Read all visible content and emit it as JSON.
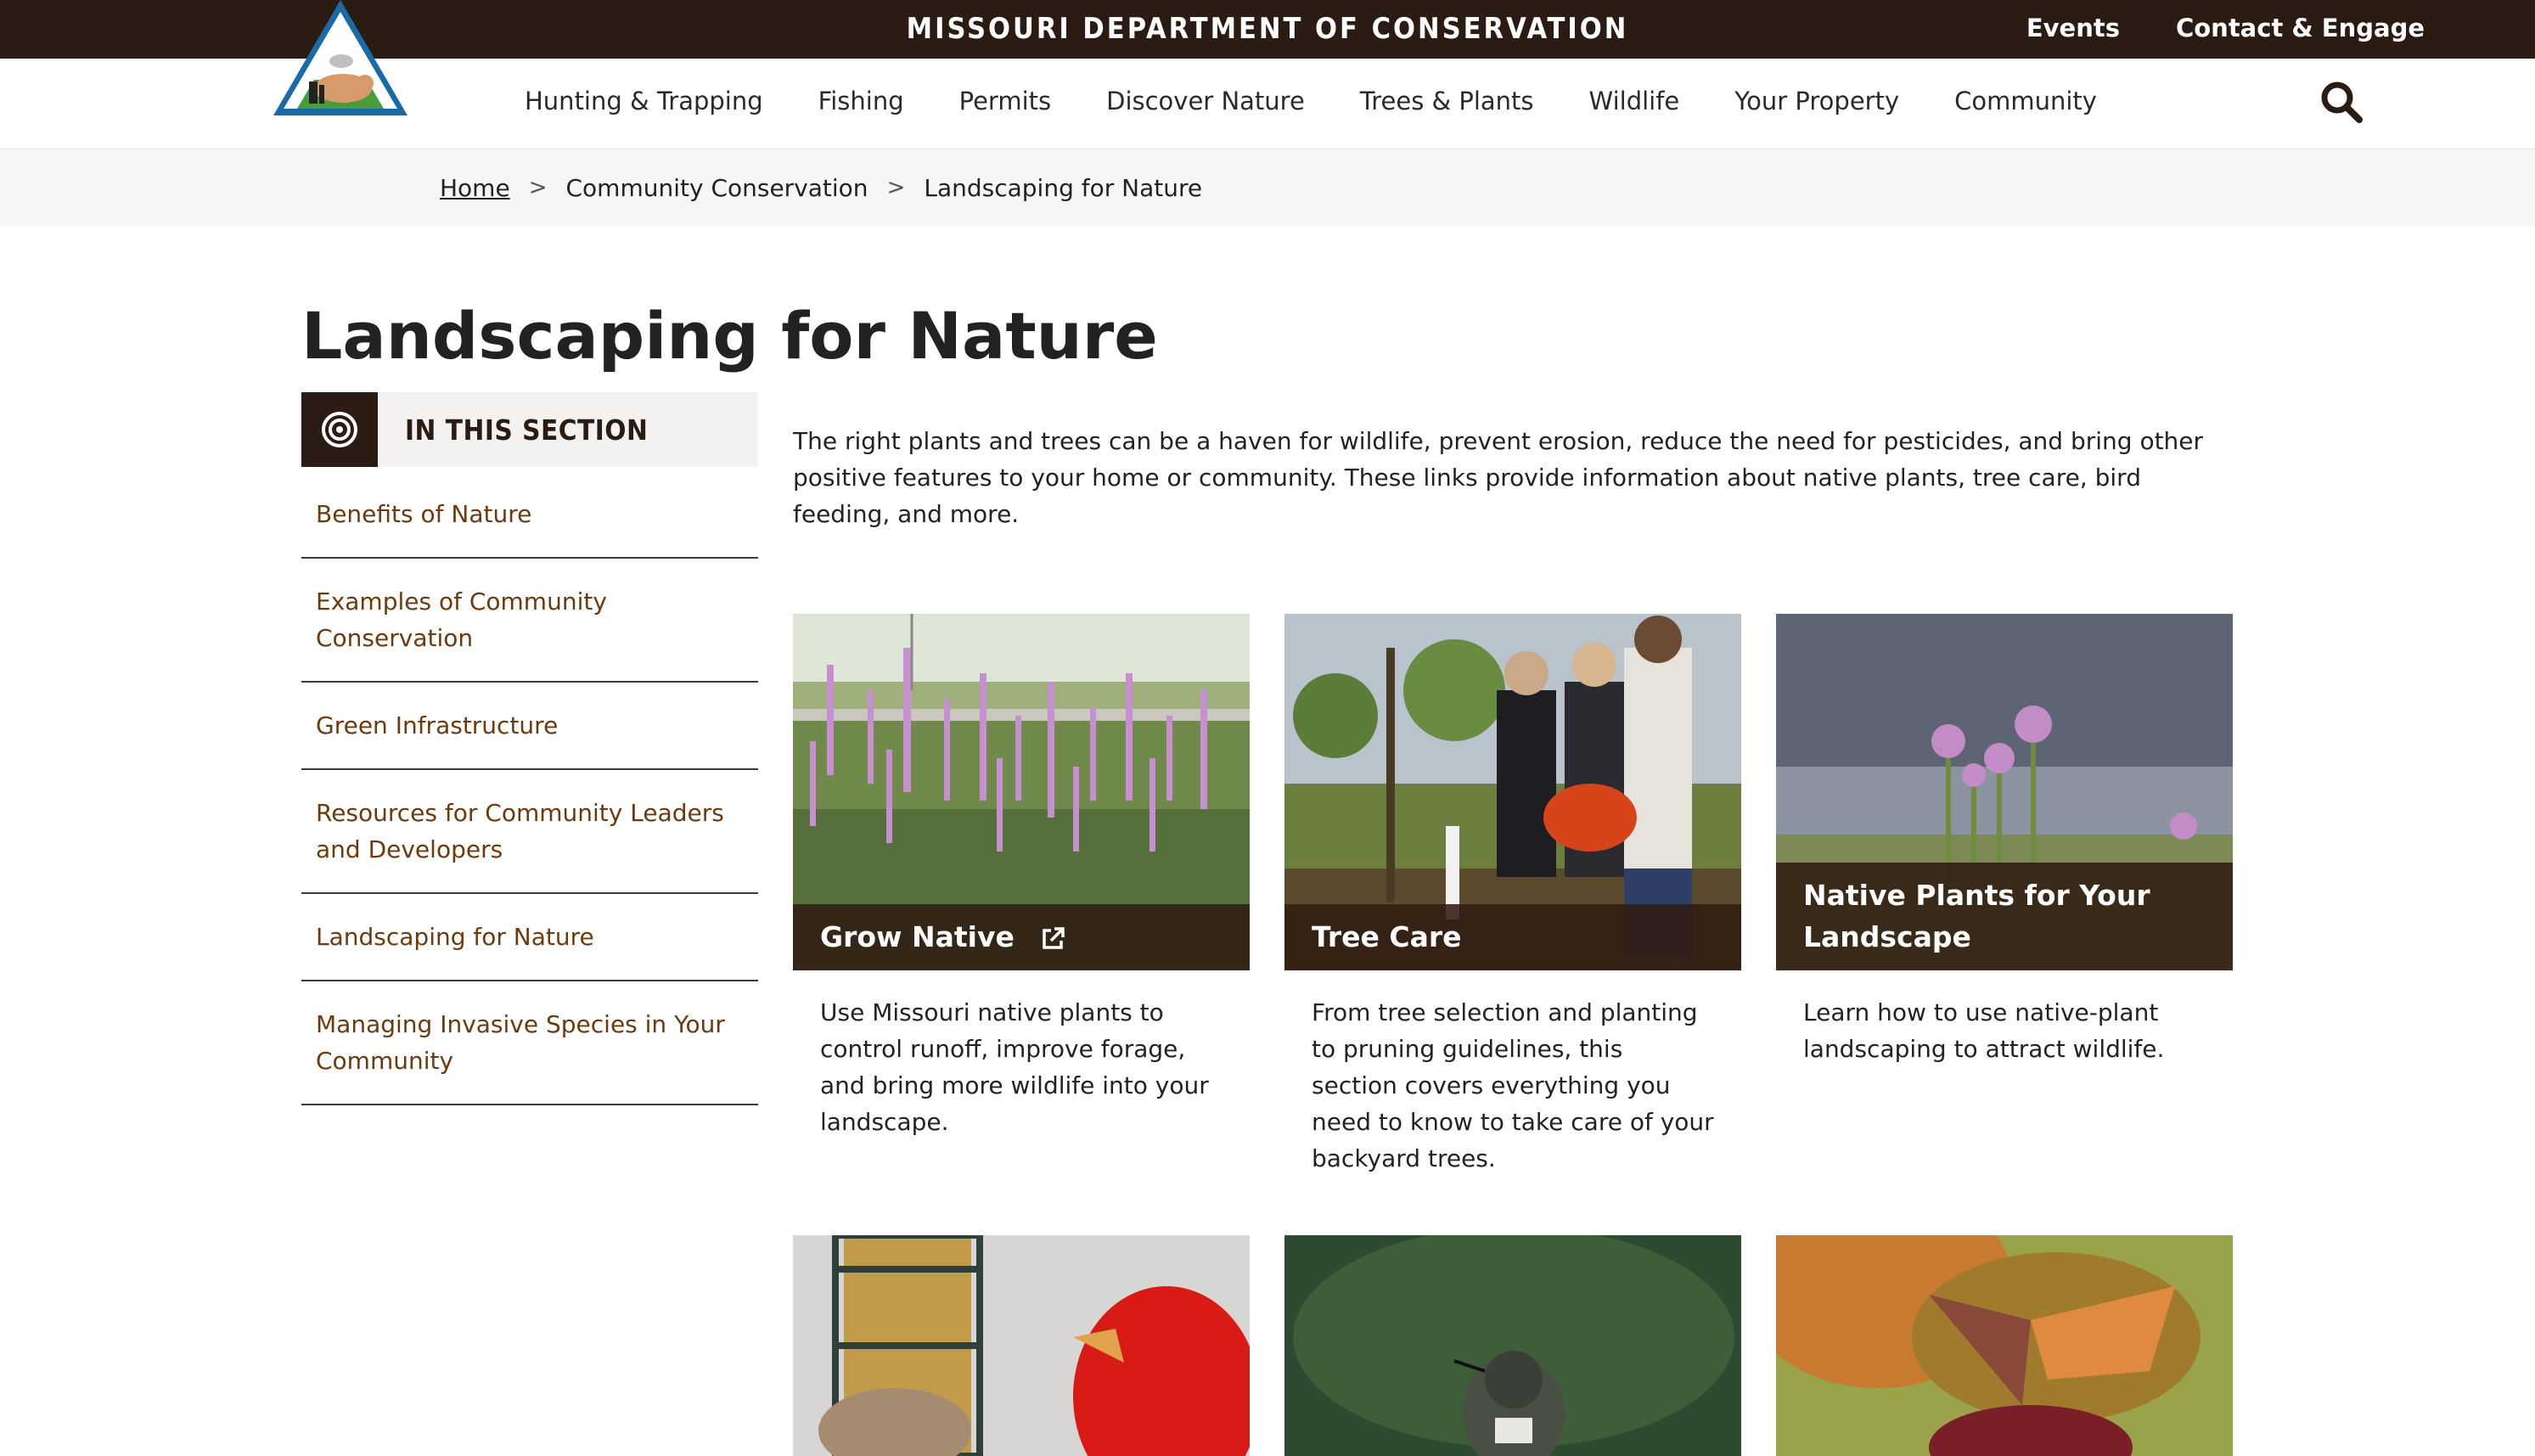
{
  "header": {
    "brand": "MISSOURI DEPARTMENT OF CONSERVATION",
    "links": [
      "Events",
      "Contact & Engage"
    ]
  },
  "nav": {
    "items": [
      "Hunting & Trapping",
      "Fishing",
      "Permits",
      "Discover Nature",
      "Trees & Plants",
      "Wildlife",
      "Your Property",
      "Community"
    ],
    "search_icon": "search-icon",
    "logo_icon": "mdc-logo-icon"
  },
  "breadcrumb": {
    "home": "Home",
    "separator": ">",
    "items": [
      "Community Conservation",
      "Landscaping for Nature"
    ]
  },
  "page": {
    "title": "Landscaping for Nature",
    "intro": "The right plants and trees can be a haven for wildlife, prevent erosion, reduce the need for pesticides, and bring other positive features to your home or community. These links provide information about native plants, tree care, bird feeding, and more."
  },
  "sidebar": {
    "heading": "IN THIS SECTION",
    "icon": "target-icon",
    "items": [
      {
        "label": "Benefits of Nature"
      },
      {
        "label": "Examples of Community Conservation"
      },
      {
        "label": "Green Infrastructure"
      },
      {
        "label": "Resources for Community Leaders and Developers"
      },
      {
        "label": "Landscaping for Nature"
      },
      {
        "label": "Managing Invasive Species in Your Community"
      }
    ]
  },
  "cards": [
    {
      "title": "Grow Native",
      "external": true,
      "description": "Use Missouri native plants to control runoff, improve forage, and bring more wildlife into your landscape."
    },
    {
      "title": "Tree Care",
      "external": false,
      "description": "From tree selection and planting to pruning guidelines, this section covers everything you need to know to take care of your backyard trees."
    },
    {
      "title": "Native Plants for Your Landscape",
      "external": false,
      "description": "Learn how to use native-plant landscaping to attract wildlife."
    }
  ],
  "colors": {
    "brand_dark": "#2a1b13",
    "link_brown": "#6d3a0e",
    "breadcrumb_bg": "#f7f6f4"
  }
}
